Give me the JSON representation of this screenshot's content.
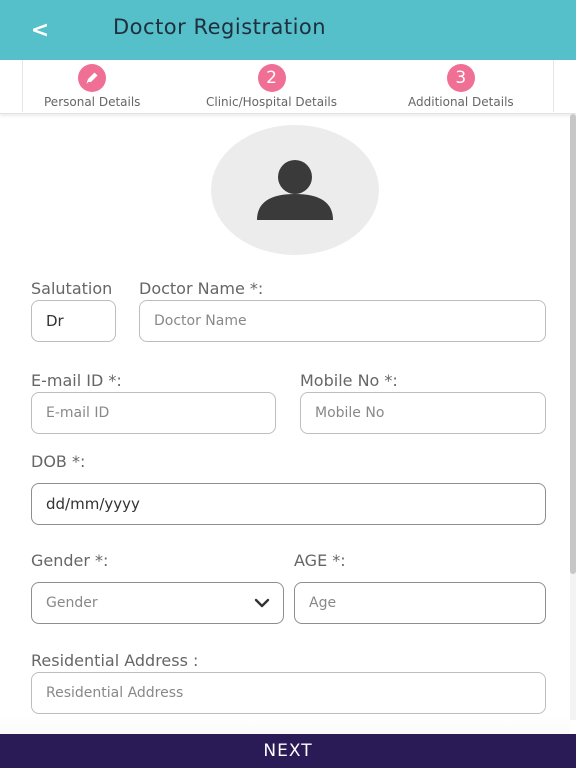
{
  "header": {
    "back_glyph": "<",
    "title": "Doctor Registration"
  },
  "steps": [
    {
      "badge": "",
      "icon": "pencil-icon",
      "label": "Personal Details"
    },
    {
      "badge": "2",
      "label": "Clinic/Hospital Details"
    },
    {
      "badge": "3",
      "label": "Additional Details"
    }
  ],
  "form": {
    "salutation": {
      "label": "Salutation",
      "value": "Dr"
    },
    "doctor_name": {
      "label": "Doctor Name *:",
      "placeholder": "Doctor Name"
    },
    "email": {
      "label": "E-mail ID *:",
      "placeholder": "E-mail ID"
    },
    "mobile": {
      "label": "Mobile No *:",
      "placeholder": "Mobile No"
    },
    "dob": {
      "label": "DOB *:",
      "placeholder": "dd/mm/yyyy"
    },
    "gender": {
      "label": "Gender *:",
      "value": "Gender"
    },
    "age": {
      "label": "AGE *:",
      "placeholder": "Age"
    },
    "residential_address": {
      "label": "Residential Address :",
      "placeholder": "Residential Address"
    }
  },
  "footer": {
    "next_label": "NEXT"
  },
  "colors": {
    "header_bg": "#55bfca",
    "step_badge": "#ef6f95",
    "next_bar": "#2a1b57"
  }
}
